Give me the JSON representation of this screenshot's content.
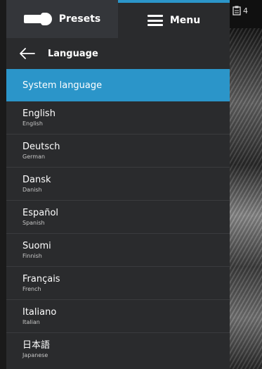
{
  "tabs": {
    "presets_label": "Presets",
    "menu_label": "Menu"
  },
  "header": {
    "title": "Language"
  },
  "system_language_label": "System language",
  "languages": [
    {
      "native": "English",
      "english": "English"
    },
    {
      "native": "Deutsch",
      "english": "German"
    },
    {
      "native": "Dansk",
      "english": "Danish"
    },
    {
      "native": "Español",
      "english": "Spanish"
    },
    {
      "native": "Suomi",
      "english": "Finnish"
    },
    {
      "native": "Français",
      "english": "French"
    },
    {
      "native": "Italiano",
      "english": "Italian"
    },
    {
      "native": "日本語",
      "english": "Japanese"
    }
  ],
  "side": {
    "indicator": "4"
  },
  "colors": {
    "accent": "#2b95c9",
    "panel": "#2a2b2d",
    "tab_inactive": "#34363a"
  },
  "icons": [
    "presets-icon",
    "hamburger-menu-icon",
    "back-arrow-icon",
    "clipboard-icon"
  ]
}
